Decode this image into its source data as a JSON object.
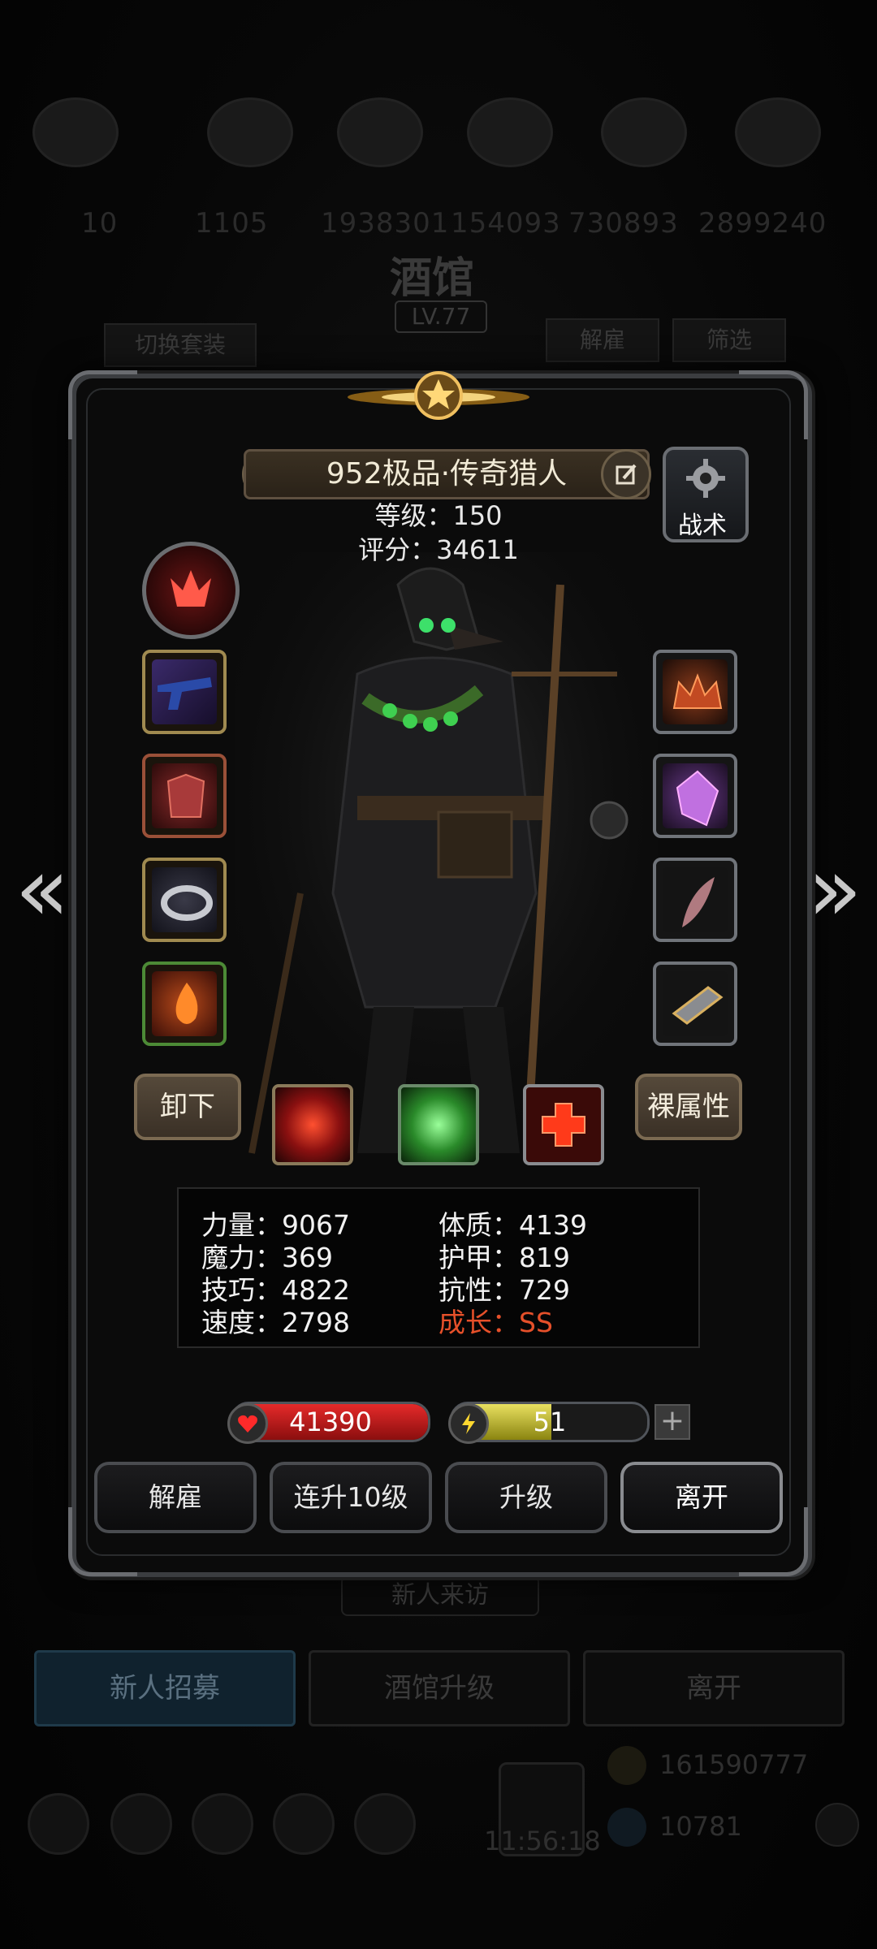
{
  "background": {
    "resource_numbers": [
      "10",
      "1105",
      "1938301",
      "154093",
      "730893",
      "2899240"
    ],
    "title": "酒馆",
    "level": "LV.77",
    "switch_outfit": "切换套装",
    "dismiss": "解雇",
    "filter": "筛选",
    "new_visitor": "新人来访",
    "tabs": [
      "新人招募",
      "酒馆升级",
      "离开"
    ],
    "gold": "161590777",
    "gems": "10781",
    "time": "11:56:18"
  },
  "hero": {
    "name": "952极品·传奇猎人",
    "level": "等级：150",
    "score": "评分：34611",
    "tactics_label": "战术"
  },
  "buttons": {
    "unequip": "卸下",
    "base_attributes": "裸属性"
  },
  "stats": {
    "strength": "力量：9067",
    "magic": "魔力：369",
    "skill": "技巧：4822",
    "speed": "速度：2798",
    "constitution": "体质：4139",
    "armor": "护甲：819",
    "resistance": "抗性：729",
    "growth": "成长：SS"
  },
  "bars": {
    "hp_value": "41390",
    "hp_fill": 1.0,
    "energy_value": "51",
    "energy_fill": 0.51,
    "plus": "+"
  },
  "actions": [
    "解雇",
    "连升10级",
    "升级",
    "离开"
  ],
  "nav": {
    "prev": "«",
    "next": "»"
  },
  "colors": {
    "growth": "#e6502a",
    "hp": "#d41c1c",
    "energy": "#d8d040",
    "frame": "#3b3d40"
  }
}
